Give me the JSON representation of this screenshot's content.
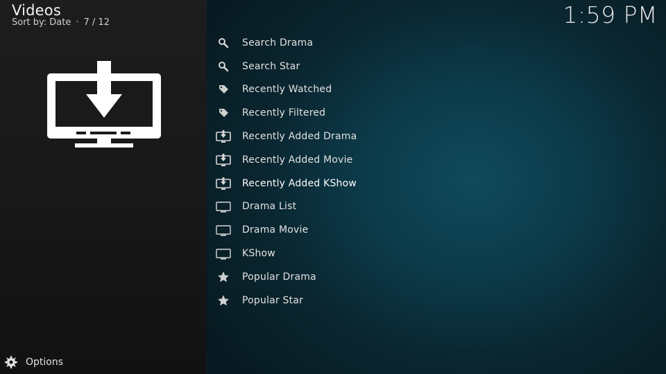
{
  "header": {
    "title": "Videos",
    "sort_label": "Sort by: Date",
    "position": "7 / 12",
    "clock": "1:59 PM"
  },
  "thumbnail": {
    "icon": "download-tv-icon"
  },
  "menu": {
    "items": [
      {
        "label": "Search Drama",
        "icon": "search-icon"
      },
      {
        "label": "Search Star",
        "icon": "search-icon"
      },
      {
        "label": "Recently Watched",
        "icon": "tag-icon"
      },
      {
        "label": "Recently Filtered",
        "icon": "tag-icon"
      },
      {
        "label": "Recently Added Drama",
        "icon": "download-tv-icon"
      },
      {
        "label": "Recently Added Movie",
        "icon": "download-tv-icon"
      },
      {
        "label": "Recently Added KShow",
        "icon": "download-tv-icon"
      },
      {
        "label": "Drama List",
        "icon": "tv-icon"
      },
      {
        "label": "Drama Movie",
        "icon": "tv-icon"
      },
      {
        "label": "KShow",
        "icon": "tv-icon"
      },
      {
        "label": "Popular Drama",
        "icon": "star-icon"
      },
      {
        "label": "Popular Star",
        "icon": "star-icon"
      }
    ],
    "focused_index": 6
  },
  "footer": {
    "options_label": "Options",
    "icon": "options-icon"
  },
  "colors": {
    "left_panel": "#1a1a1a",
    "right_accent": "#0f4a5c",
    "text": "#e2e2e2"
  }
}
